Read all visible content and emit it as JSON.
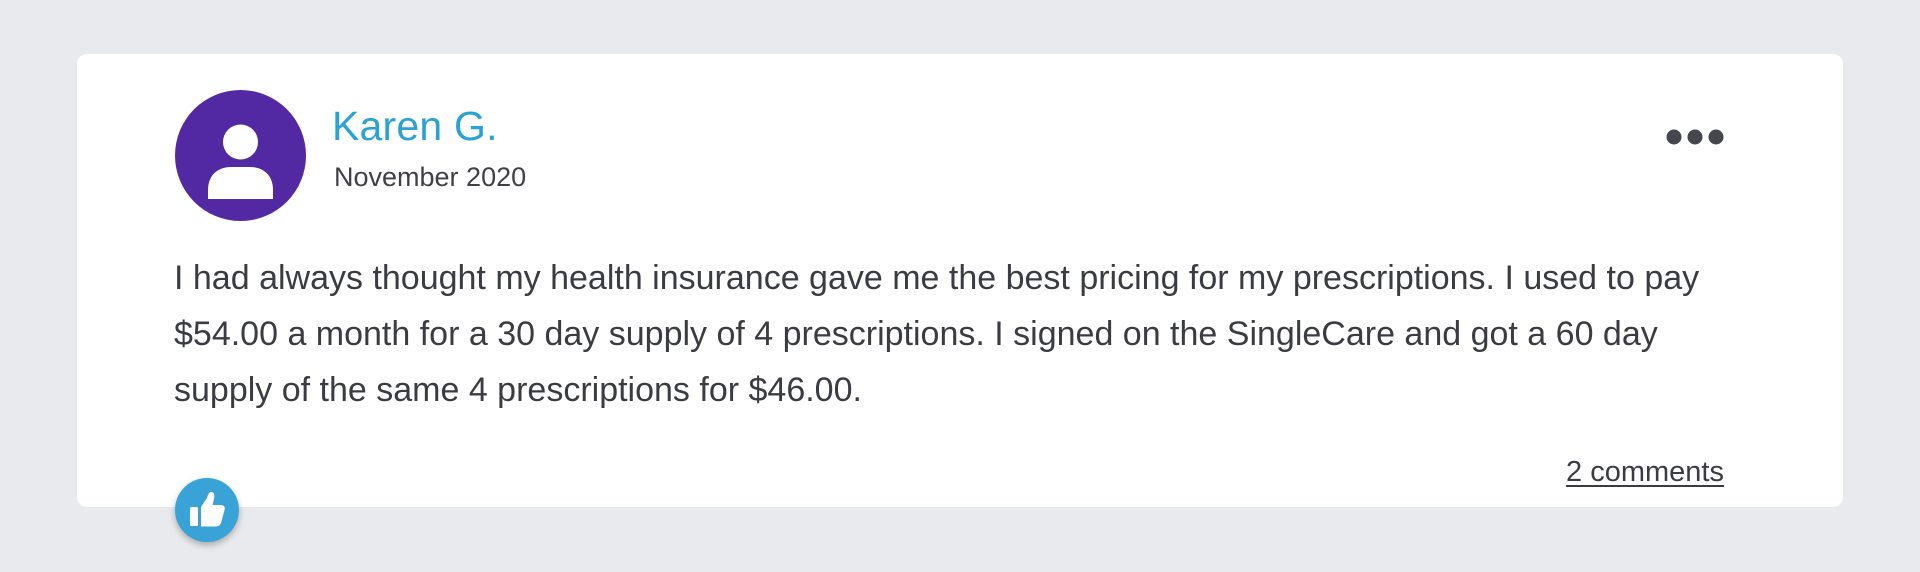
{
  "review": {
    "author": "Karen G.",
    "date": "November 2020",
    "avatar_icon": "user-silhouette-icon",
    "text": "I had always thought my health insurance gave me the best pricing for my prescriptions. I used to pay $54.00 a month for a 30 day supply of 4 prescriptions. I signed on the SingleCare and got a 60 day supply of the same 4 prescriptions for $46.00.",
    "comments_label": "2 comments",
    "more_icon": "more-options-icon",
    "like_icon": "thumbs-up-icon"
  },
  "colors": {
    "page_background": "#e9eaed",
    "card_background": "#ffffff",
    "avatar": "#5329a3",
    "author_name": "#2aa3d4",
    "body_text": "#3a3c42",
    "like_button": "#39a3d8"
  }
}
